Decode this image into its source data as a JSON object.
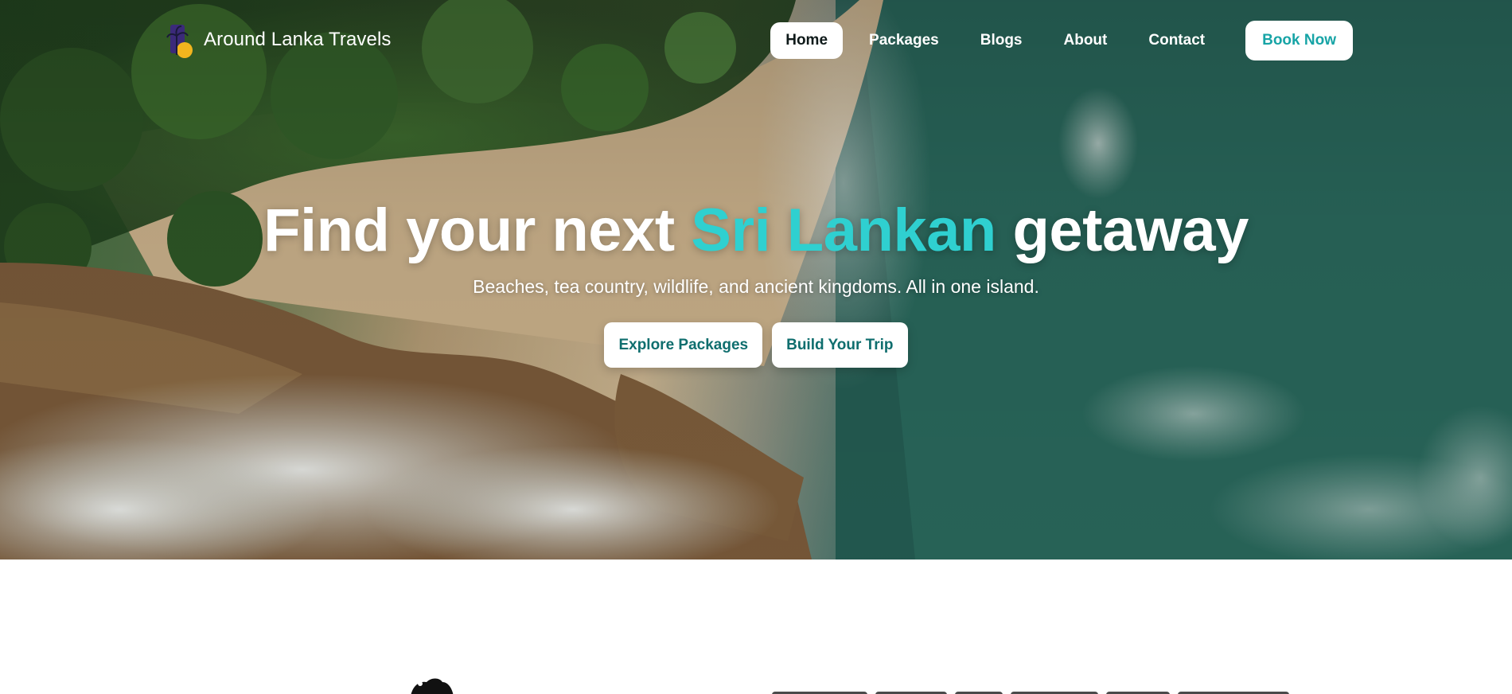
{
  "brand": {
    "name": "Around Lanka Travels",
    "logo_icon": "palm-sunset-logo"
  },
  "nav": {
    "links": [
      {
        "label": "Home",
        "active": true
      },
      {
        "label": "Packages",
        "active": false
      },
      {
        "label": "Blogs",
        "active": false
      },
      {
        "label": "About",
        "active": false
      },
      {
        "label": "Contact",
        "active": false
      }
    ],
    "cta_label": "Book Now"
  },
  "hero": {
    "headline_before": "Find your next",
    "headline_accent": "Sri Lankan",
    "headline_after": "getaway",
    "subline": "Beaches, tea country, wildlife, and ancient kingdoms. All in one island.",
    "buttons": [
      {
        "label": "Explore Packages"
      },
      {
        "label": "Build Your Trip"
      }
    ],
    "background_image": "aerial-coastline-photo"
  },
  "colors": {
    "accent": "#2fd0d0",
    "cta_text": "#17a4a6",
    "button_text": "#0f6e6e"
  }
}
